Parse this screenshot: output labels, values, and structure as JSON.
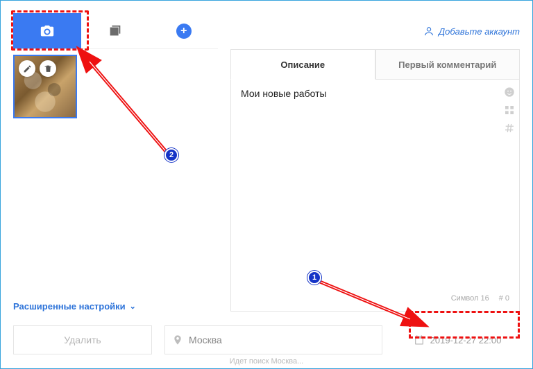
{
  "leftTabs": {
    "active": "camera"
  },
  "thumb": {
    "editTitle": "Редактировать",
    "deleteTitle": "Удалить"
  },
  "advanced": "Расширенные настройки",
  "addAccount": "Добавьте аккаунт",
  "descTabs": {
    "description": "Описание",
    "firstComment": "Первый комментарий"
  },
  "editor": {
    "text": "Мои новые работы",
    "charLabel": "Символ 16",
    "hashLabel": "# 0"
  },
  "bottom": {
    "delete": "Удалить",
    "locationValue": "Москва",
    "dateValue": "2019-12-27 22:00"
  },
  "status": "Идет поиск Москва...",
  "badges": {
    "one": "1",
    "two": "2"
  }
}
